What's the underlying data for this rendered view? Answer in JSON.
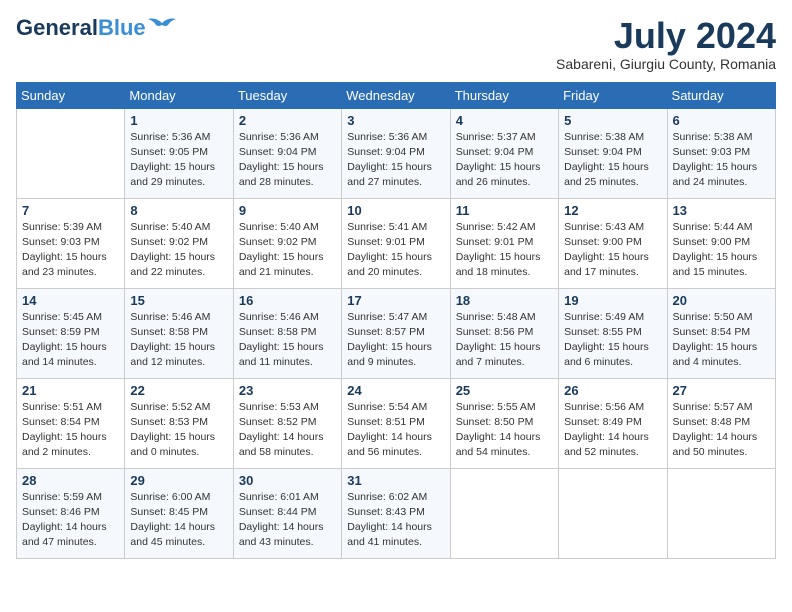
{
  "logo": {
    "line1": "General",
    "line2": "Blue"
  },
  "title": {
    "month_year": "July 2024",
    "location": "Sabareni, Giurgiu County, Romania"
  },
  "weekdays": [
    "Sunday",
    "Monday",
    "Tuesday",
    "Wednesday",
    "Thursday",
    "Friday",
    "Saturday"
  ],
  "weeks": [
    [
      {
        "day": "",
        "info": ""
      },
      {
        "day": "1",
        "info": "Sunrise: 5:36 AM\nSunset: 9:05 PM\nDaylight: 15 hours\nand 29 minutes."
      },
      {
        "day": "2",
        "info": "Sunrise: 5:36 AM\nSunset: 9:04 PM\nDaylight: 15 hours\nand 28 minutes."
      },
      {
        "day": "3",
        "info": "Sunrise: 5:36 AM\nSunset: 9:04 PM\nDaylight: 15 hours\nand 27 minutes."
      },
      {
        "day": "4",
        "info": "Sunrise: 5:37 AM\nSunset: 9:04 PM\nDaylight: 15 hours\nand 26 minutes."
      },
      {
        "day": "5",
        "info": "Sunrise: 5:38 AM\nSunset: 9:04 PM\nDaylight: 15 hours\nand 25 minutes."
      },
      {
        "day": "6",
        "info": "Sunrise: 5:38 AM\nSunset: 9:03 PM\nDaylight: 15 hours\nand 24 minutes."
      }
    ],
    [
      {
        "day": "7",
        "info": "Sunrise: 5:39 AM\nSunset: 9:03 PM\nDaylight: 15 hours\nand 23 minutes."
      },
      {
        "day": "8",
        "info": "Sunrise: 5:40 AM\nSunset: 9:02 PM\nDaylight: 15 hours\nand 22 minutes."
      },
      {
        "day": "9",
        "info": "Sunrise: 5:40 AM\nSunset: 9:02 PM\nDaylight: 15 hours\nand 21 minutes."
      },
      {
        "day": "10",
        "info": "Sunrise: 5:41 AM\nSunset: 9:01 PM\nDaylight: 15 hours\nand 20 minutes."
      },
      {
        "day": "11",
        "info": "Sunrise: 5:42 AM\nSunset: 9:01 PM\nDaylight: 15 hours\nand 18 minutes."
      },
      {
        "day": "12",
        "info": "Sunrise: 5:43 AM\nSunset: 9:00 PM\nDaylight: 15 hours\nand 17 minutes."
      },
      {
        "day": "13",
        "info": "Sunrise: 5:44 AM\nSunset: 9:00 PM\nDaylight: 15 hours\nand 15 minutes."
      }
    ],
    [
      {
        "day": "14",
        "info": "Sunrise: 5:45 AM\nSunset: 8:59 PM\nDaylight: 15 hours\nand 14 minutes."
      },
      {
        "day": "15",
        "info": "Sunrise: 5:46 AM\nSunset: 8:58 PM\nDaylight: 15 hours\nand 12 minutes."
      },
      {
        "day": "16",
        "info": "Sunrise: 5:46 AM\nSunset: 8:58 PM\nDaylight: 15 hours\nand 11 minutes."
      },
      {
        "day": "17",
        "info": "Sunrise: 5:47 AM\nSunset: 8:57 PM\nDaylight: 15 hours\nand 9 minutes."
      },
      {
        "day": "18",
        "info": "Sunrise: 5:48 AM\nSunset: 8:56 PM\nDaylight: 15 hours\nand 7 minutes."
      },
      {
        "day": "19",
        "info": "Sunrise: 5:49 AM\nSunset: 8:55 PM\nDaylight: 15 hours\nand 6 minutes."
      },
      {
        "day": "20",
        "info": "Sunrise: 5:50 AM\nSunset: 8:54 PM\nDaylight: 15 hours\nand 4 minutes."
      }
    ],
    [
      {
        "day": "21",
        "info": "Sunrise: 5:51 AM\nSunset: 8:54 PM\nDaylight: 15 hours\nand 2 minutes."
      },
      {
        "day": "22",
        "info": "Sunrise: 5:52 AM\nSunset: 8:53 PM\nDaylight: 15 hours\nand 0 minutes."
      },
      {
        "day": "23",
        "info": "Sunrise: 5:53 AM\nSunset: 8:52 PM\nDaylight: 14 hours\nand 58 minutes."
      },
      {
        "day": "24",
        "info": "Sunrise: 5:54 AM\nSunset: 8:51 PM\nDaylight: 14 hours\nand 56 minutes."
      },
      {
        "day": "25",
        "info": "Sunrise: 5:55 AM\nSunset: 8:50 PM\nDaylight: 14 hours\nand 54 minutes."
      },
      {
        "day": "26",
        "info": "Sunrise: 5:56 AM\nSunset: 8:49 PM\nDaylight: 14 hours\nand 52 minutes."
      },
      {
        "day": "27",
        "info": "Sunrise: 5:57 AM\nSunset: 8:48 PM\nDaylight: 14 hours\nand 50 minutes."
      }
    ],
    [
      {
        "day": "28",
        "info": "Sunrise: 5:59 AM\nSunset: 8:46 PM\nDaylight: 14 hours\nand 47 minutes."
      },
      {
        "day": "29",
        "info": "Sunrise: 6:00 AM\nSunset: 8:45 PM\nDaylight: 14 hours\nand 45 minutes."
      },
      {
        "day": "30",
        "info": "Sunrise: 6:01 AM\nSunset: 8:44 PM\nDaylight: 14 hours\nand 43 minutes."
      },
      {
        "day": "31",
        "info": "Sunrise: 6:02 AM\nSunset: 8:43 PM\nDaylight: 14 hours\nand 41 minutes."
      },
      {
        "day": "",
        "info": ""
      },
      {
        "day": "",
        "info": ""
      },
      {
        "day": "",
        "info": ""
      }
    ]
  ]
}
